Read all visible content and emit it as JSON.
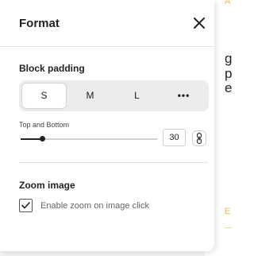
{
  "panel": {
    "title": "Format",
    "close_label": "Close"
  },
  "block_padding": {
    "label": "Block padding",
    "options": [
      "S",
      "M",
      "L",
      "•••"
    ],
    "selected": "S"
  },
  "top_bottom": {
    "label": "Top and Bottom",
    "value": "30",
    "slider_fraction": 0.16
  },
  "zoom": {
    "label": "Zoom image",
    "checkbox_label": "Enable zoom on image click",
    "checked": true
  },
  "background": {
    "accent_top": "ALL",
    "line1": "g",
    "line2": "p",
    "line3": "ee",
    "accent_bottom": "E"
  },
  "colors": {
    "accent": "#f0b84a",
    "text": "#222222",
    "segment_bg": "#ececec"
  },
  "icons": {
    "close": "close-icon",
    "link": "link-icon",
    "check": "check-icon",
    "more": "more-icon"
  }
}
